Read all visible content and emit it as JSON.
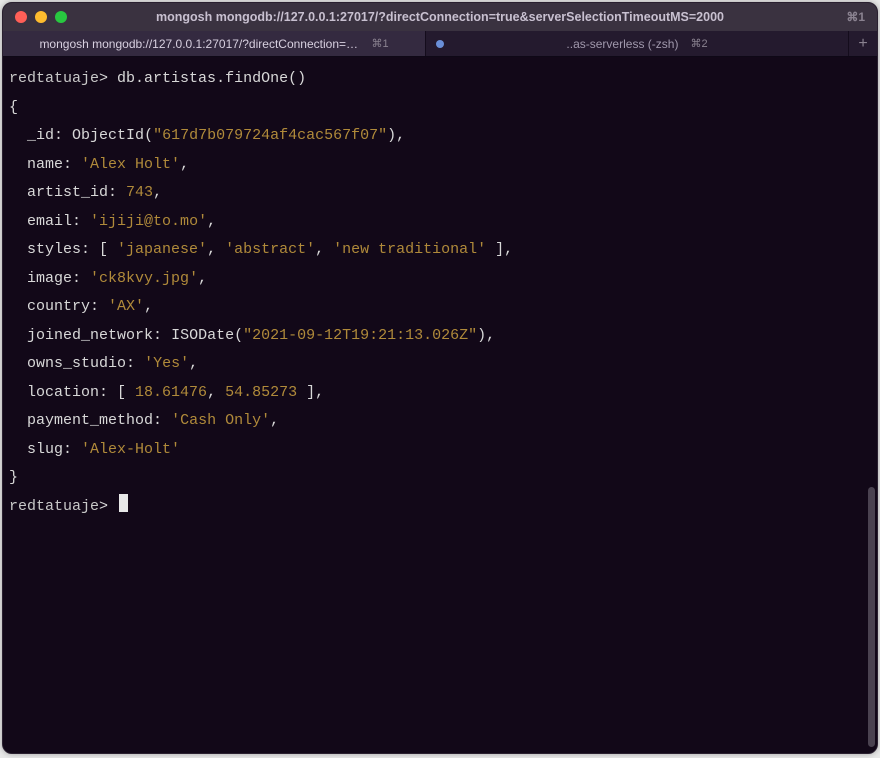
{
  "window": {
    "title": "mongosh mongodb://127.0.0.1:27017/?directConnection=true&serverSelectionTimeoutMS=2000",
    "shortcut": "⌘1"
  },
  "tabs": [
    {
      "label": "mongosh mongodb://127.0.0.1:27017/?directConnection=true&ser...",
      "shortcut": "⌘1",
      "active": true,
      "indicator": false
    },
    {
      "label": "..as-serverless (-zsh)",
      "shortcut": "⌘2",
      "active": false,
      "indicator": true
    }
  ],
  "newtab_glyph": "+",
  "terminal": {
    "prompt_db": "redtatuaje",
    "prompt_suffix": ">",
    "command": "db.artistas.findOne()",
    "doc": {
      "id_fn": "ObjectId",
      "id_arg": "\"617d7b079724af4cac567f07\"",
      "name": "'Alex Holt'",
      "artist_id": "743",
      "email": "'ijiji@to.mo'",
      "styles": [
        "'japanese'",
        "'abstract'",
        "'new traditional'"
      ],
      "image": "'ck8kvy.jpg'",
      "country": "'AX'",
      "joined_fn": "ISODate",
      "joined_arg": "\"2021-09-12T19:21:13.026Z\"",
      "owns_studio": "'Yes'",
      "location": [
        "18.61476",
        "54.85273"
      ],
      "payment_method": "'Cash Only'",
      "slug": "'Alex-Holt'"
    },
    "keys": {
      "_id": "_id",
      "name": "name",
      "artist_id": "artist_id",
      "email": "email",
      "styles": "styles",
      "image": "image",
      "country": "country",
      "joined_network": "joined_network",
      "owns_studio": "owns_studio",
      "location": "location",
      "payment_method": "payment_method",
      "slug": "slug"
    }
  }
}
